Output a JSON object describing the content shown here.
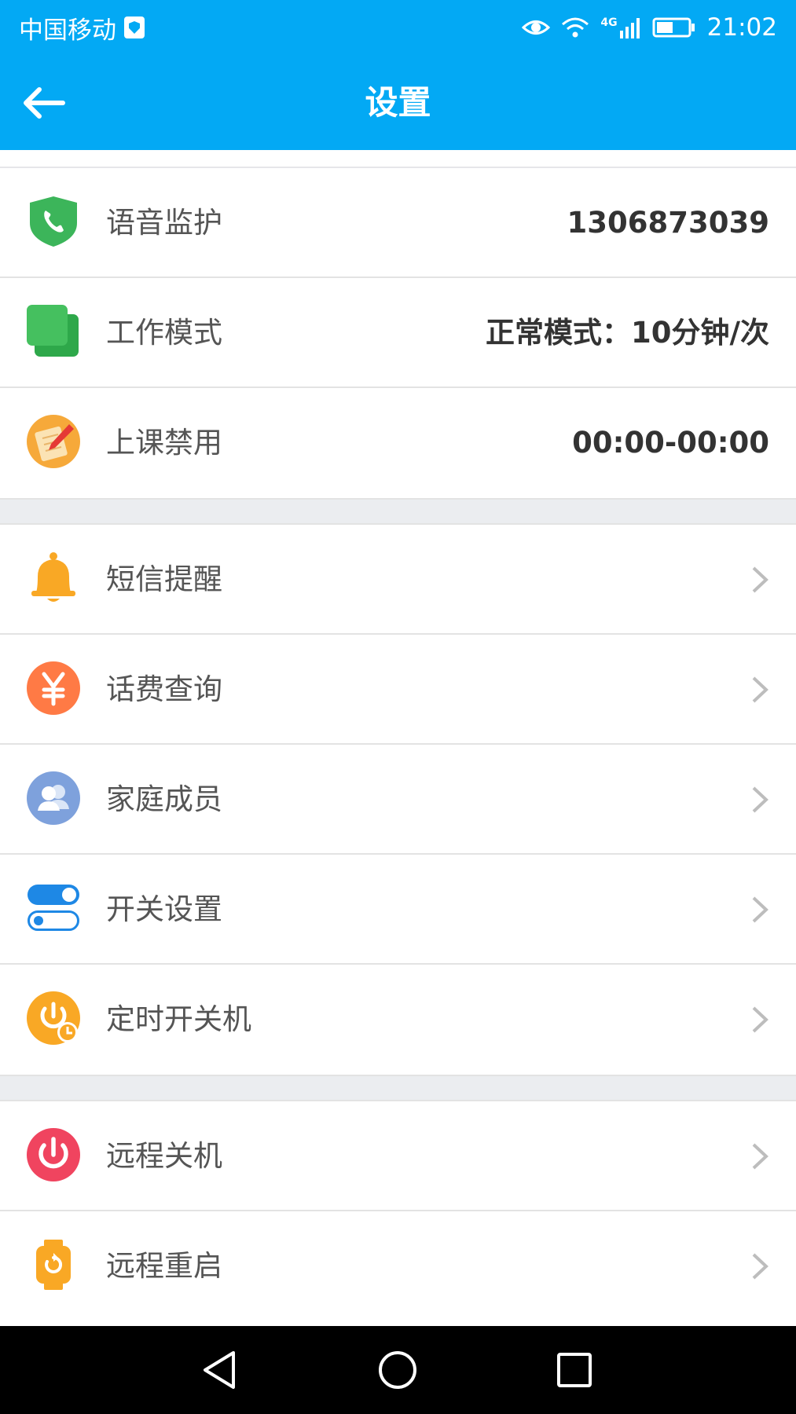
{
  "status_bar": {
    "carrier": "中国移动",
    "network": "4G",
    "time": "21:02"
  },
  "header": {
    "title": "设置"
  },
  "groups": [
    {
      "items": [
        {
          "label": "语音监护",
          "value": "1306873039",
          "icon": "phone-shield-icon"
        },
        {
          "label": "工作模式",
          "value": "正常模式：10分钟/次",
          "icon": "layers-icon"
        },
        {
          "label": "上课禁用",
          "value": "00:00-00:00",
          "icon": "pencil-note-icon"
        }
      ]
    },
    {
      "items": [
        {
          "label": "短信提醒",
          "icon": "bell-icon"
        },
        {
          "label": "话费查询",
          "icon": "yen-icon"
        },
        {
          "label": "家庭成员",
          "icon": "family-icon"
        },
        {
          "label": "开关设置",
          "icon": "toggle-icon"
        },
        {
          "label": "定时开关机",
          "icon": "timer-power-icon"
        }
      ]
    },
    {
      "items": [
        {
          "label": "远程关机",
          "icon": "power-icon"
        },
        {
          "label": "远程重启",
          "icon": "watch-restart-icon"
        }
      ]
    }
  ],
  "colors": {
    "header_bg": "#03a9f4",
    "separator_bg": "#ebedf0",
    "label_text": "#555555",
    "value_text": "#333333"
  }
}
